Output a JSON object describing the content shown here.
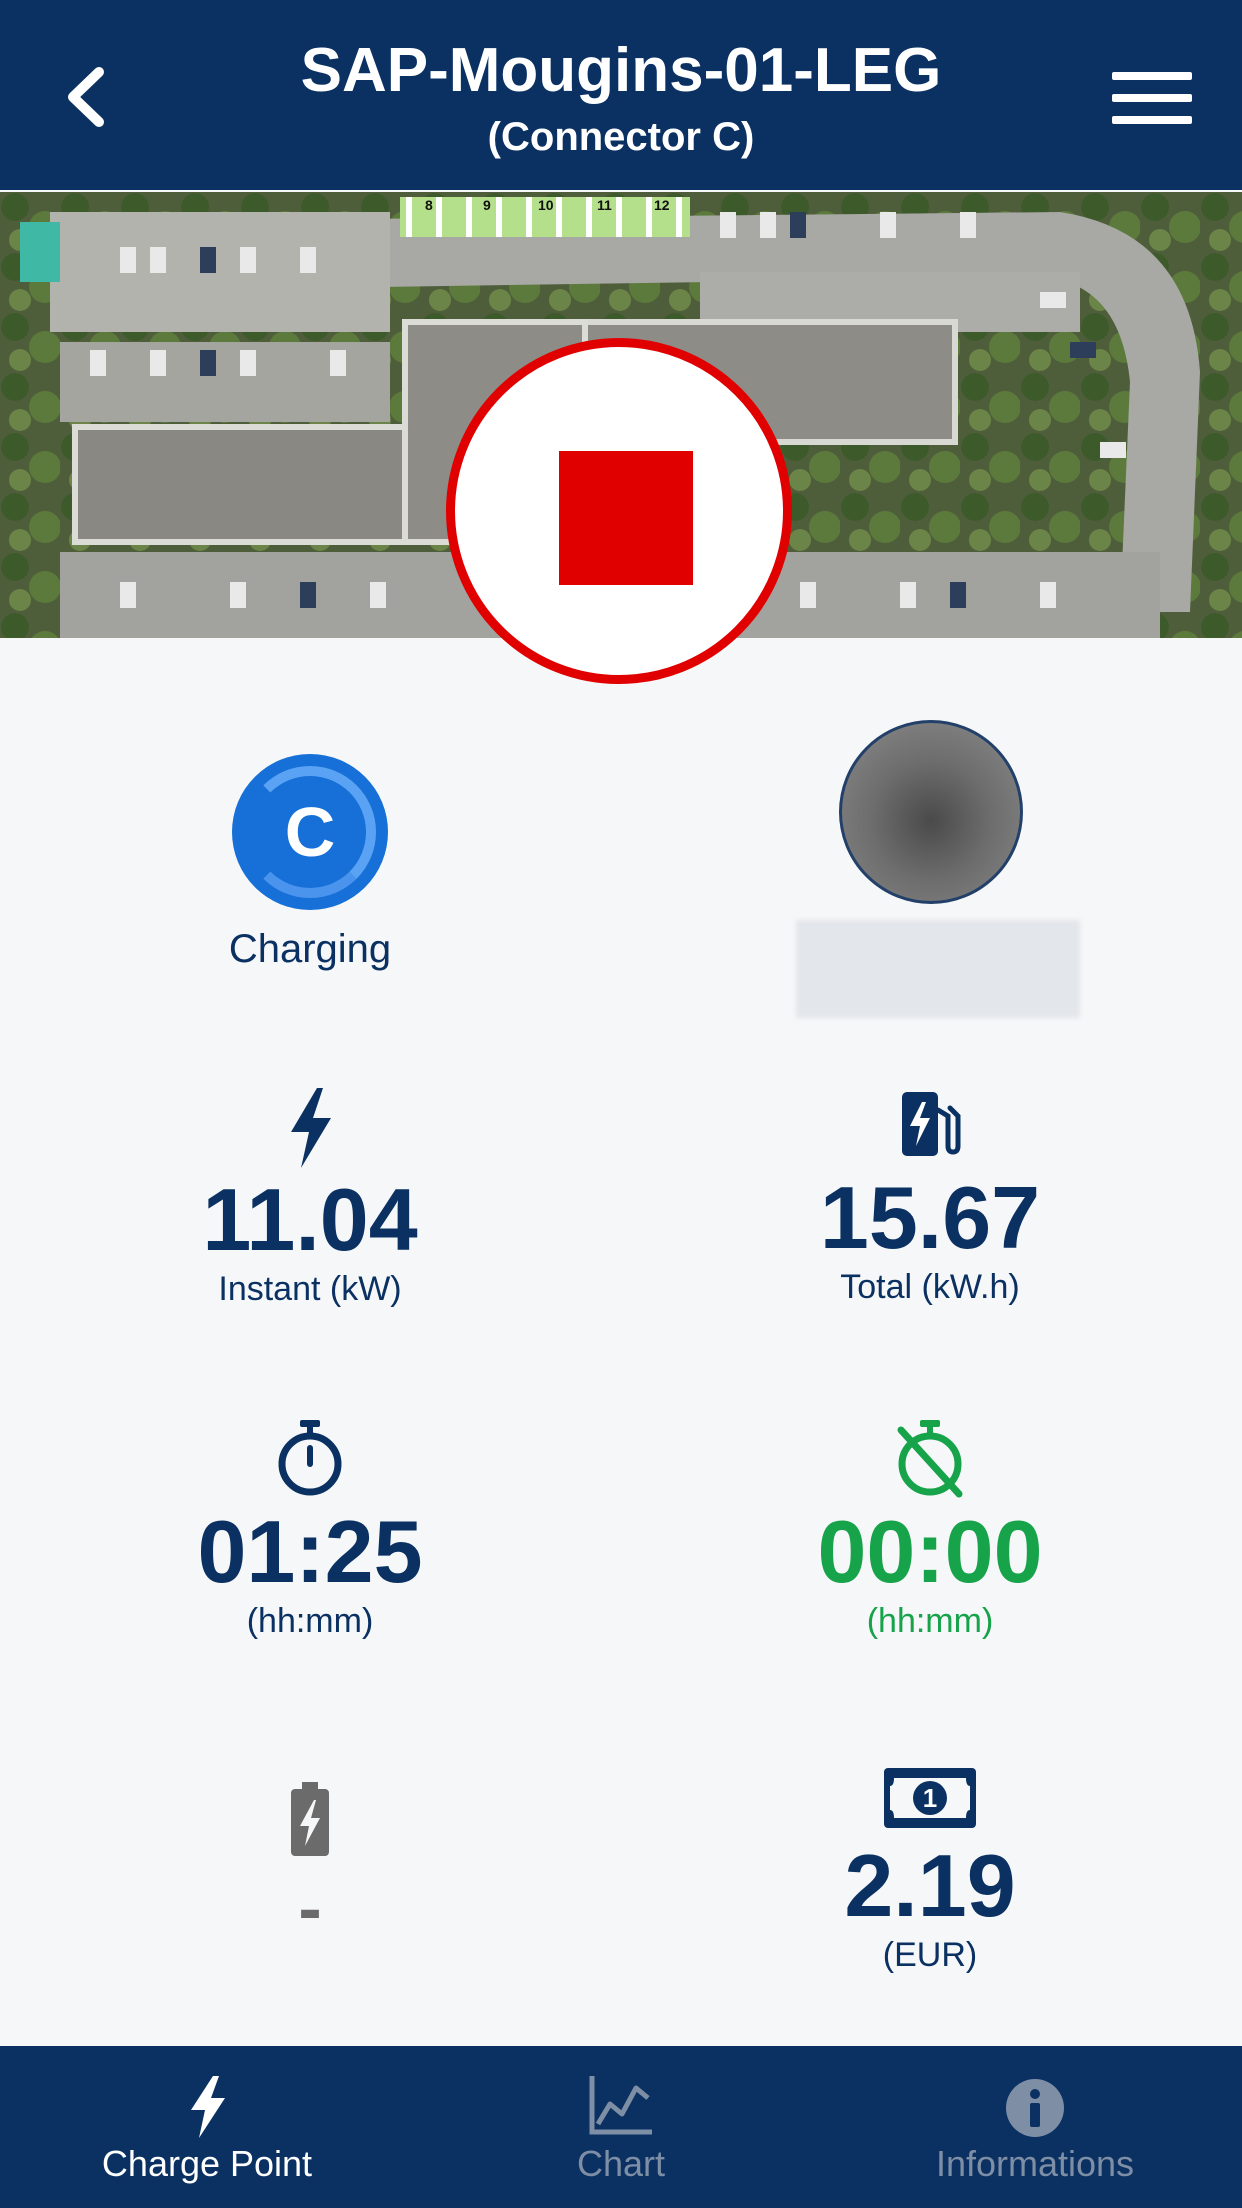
{
  "header": {
    "title": "SAP-Mougins-01-LEG",
    "subtitle": "(Connector C)"
  },
  "map": {
    "slot_numbers": [
      "8",
      "9",
      "10",
      "11",
      "12"
    ]
  },
  "connector": {
    "letter": "C",
    "status": "Charging",
    "status_color": "#1670d8"
  },
  "metrics": {
    "instant": {
      "value": "11.04",
      "label": "Instant (kW)",
      "icon": "lightning-icon"
    },
    "total": {
      "value": "15.67",
      "label": "Total (kW.h)",
      "icon": "charging-station-icon"
    },
    "duration": {
      "value": "01:25",
      "label": "(hh:mm)",
      "icon": "stopwatch-icon"
    },
    "inactivity": {
      "value": "00:00",
      "label": "(hh:mm)",
      "icon": "stopwatch-off-icon",
      "color": "#16a34a"
    },
    "battery": {
      "value": "-",
      "icon": "battery-charging-icon"
    },
    "price": {
      "value": "2.19",
      "label": "(EUR)",
      "icon": "banknote-icon"
    }
  },
  "tabs": [
    {
      "label": "Charge Point",
      "icon": "lightning-icon",
      "active": true
    },
    {
      "label": "Chart",
      "icon": "chart-icon",
      "active": false
    },
    {
      "label": "Informations",
      "icon": "info-icon",
      "active": false
    }
  ],
  "colors": {
    "primary": "#0a3162",
    "stop": "#e10000",
    "accent_green": "#16a34a",
    "background": "#f6f7f8"
  }
}
